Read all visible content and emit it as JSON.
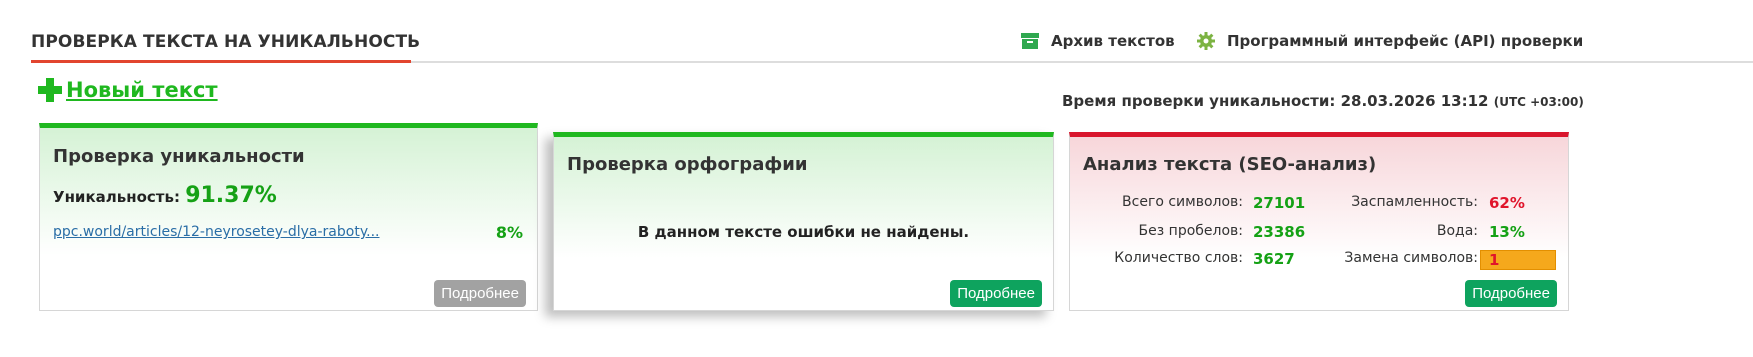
{
  "header": {
    "title": "ПРОВЕРКА ТЕКСТА НА УНИКАЛЬНОСТЬ",
    "archive_link": "Архив текстов",
    "api_link": "Программный интерфейс (API) проверки"
  },
  "new_text": {
    "label": "Новый текст"
  },
  "check_time": {
    "label": "Время проверки уникальности:",
    "value": "28.03.2026 13:12",
    "timezone": "(UTC +03:00)"
  },
  "uniqueness_card": {
    "title": "Проверка уникальности",
    "uniqueness_label": "Уникальность:",
    "uniqueness_value": "91.37%",
    "source_url": "ppc.world/articles/12-neyrosetey-dlya-raboty...",
    "source_percent": "8%",
    "more_button": "Подробнее"
  },
  "spelling_card": {
    "title": "Проверка орфографии",
    "message": "В данном тексте ошибки не найдены.",
    "more_button": "Подробнее"
  },
  "seo_card": {
    "title": "Анализ текста (SEO-анализ)",
    "stats": {
      "total_chars_label": "Всего символов:",
      "total_chars": "27101",
      "no_spaces_label": "Без пробелов:",
      "no_spaces": "23386",
      "words_label": "Количество слов:",
      "words": "3627",
      "spam_label": "Заспамленность:",
      "spam": "62%",
      "water_label": "Вода:",
      "water": "13%",
      "replace_label": "Замена символов:",
      "replace": "1"
    },
    "more_button": "Подробнее"
  },
  "colors": {
    "accent_green": "#1fb81f",
    "accent_red": "#d9162d",
    "link_blue": "#2a6ea6",
    "button_green": "#0ea35e",
    "button_gray": "#a2a2a2",
    "highlight_orange": "#f5a81c"
  },
  "icons": {
    "archive": "archive-box-icon",
    "api": "gear-icon",
    "new_text": "plus-icon"
  }
}
